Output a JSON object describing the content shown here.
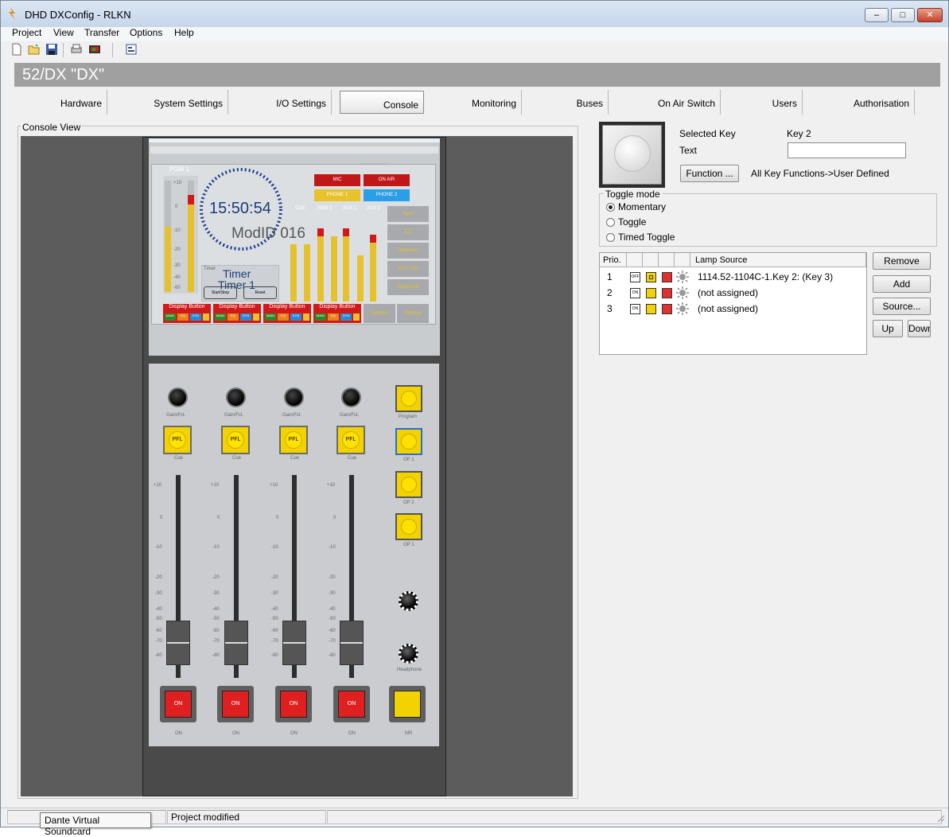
{
  "window": {
    "title": "DHD DXConfig - RLKN"
  },
  "menu": [
    "Project",
    "View",
    "Transfer",
    "Options",
    "Help"
  ],
  "header": {
    "device_title": "52/DX \"DX\""
  },
  "tabs": [
    "Hardware",
    "System Settings",
    "I/O Settings",
    "Console",
    "Monitoring",
    "Buses",
    "On Air Switch",
    "Users",
    "Authorisation"
  ],
  "active_tab": "Console",
  "console_view": {
    "label": "Console View",
    "screen": {
      "meter_title": "PGM 1",
      "clock": "15:50:54",
      "mod_id": "ModID 016",
      "timer_small": "Timer",
      "timer_title": "Timer",
      "timer_sub": "Timer 1",
      "timer_btn_start": "Start/Stop",
      "timer_btn_reset": "Reset",
      "buttons": {
        "mic": "MIC",
        "on_air": "ON AIR",
        "phone1": "PHONE 1",
        "phone2": "PHONE 2"
      },
      "meter_labels": [
        "CUE",
        "PGM 2",
        "AUX 1",
        "AUX 2"
      ],
      "scale": [
        "+10",
        "0",
        "-10",
        "-20",
        "-30",
        "-40",
        "-60"
      ],
      "side_buttons": [
        "Input",
        "EQ",
        "Dynamics",
        "AUX / OP",
        "Snapshots"
      ],
      "display_buttons": [
        "Display Button",
        "Display Button",
        "Display Button",
        "Display Button"
      ],
      "display_sub": [
        "MAIN",
        "EQ",
        "DYN"
      ],
      "bottom_buttons": [
        "Selector",
        "Settings"
      ]
    },
    "module": {
      "gain_label": "Gain/Fct.",
      "pfl_label": "PFL",
      "cue_label": "Cue",
      "on_label": "ON",
      "fader_scale": [
        "+10",
        "0",
        "-10",
        "-20",
        "-30",
        "-40",
        "-50",
        "-60",
        "-70",
        "-80"
      ],
      "right_keys": [
        "Program",
        "OP 1",
        "OP 2",
        "OP 1"
      ],
      "headphone_label": "Headphone",
      "mr_label": "MR"
    }
  },
  "key_panel": {
    "selected_key_label": "Selected Key",
    "selected_key_value": "Key 2",
    "text_label": "Text",
    "text_value": "",
    "function_button": "Function ...",
    "function_value": "All Key Functions->User Defined",
    "toggle_mode": {
      "label": "Toggle mode",
      "options": [
        "Momentary",
        "Toggle",
        "Timed Toggle"
      ],
      "selected": "Momentary"
    },
    "lamp_table": {
      "headers": [
        "Prio.",
        "",
        "",
        "",
        "",
        "Lamp Source"
      ],
      "rows": [
        {
          "prio": "1",
          "state": "OFF",
          "color1": "#f2d200",
          "color2": "#e03030",
          "source": "1114.52-1104C-1.Key 2: (Key 3)"
        },
        {
          "prio": "2",
          "state": "ON",
          "color1": "#f2d200",
          "color2": "#e03030",
          "source": "(not assigned)"
        },
        {
          "prio": "3",
          "state": "ON",
          "color1": "#f2d200",
          "color2": "#e03030",
          "source": "(not assigned)"
        }
      ]
    },
    "buttons": {
      "remove": "Remove",
      "add": "Add",
      "source": "Source...",
      "up": "Up",
      "down": "Down"
    }
  },
  "status": {
    "message": "Project modified",
    "tooltip": "Dante Virtual Soundcard"
  }
}
